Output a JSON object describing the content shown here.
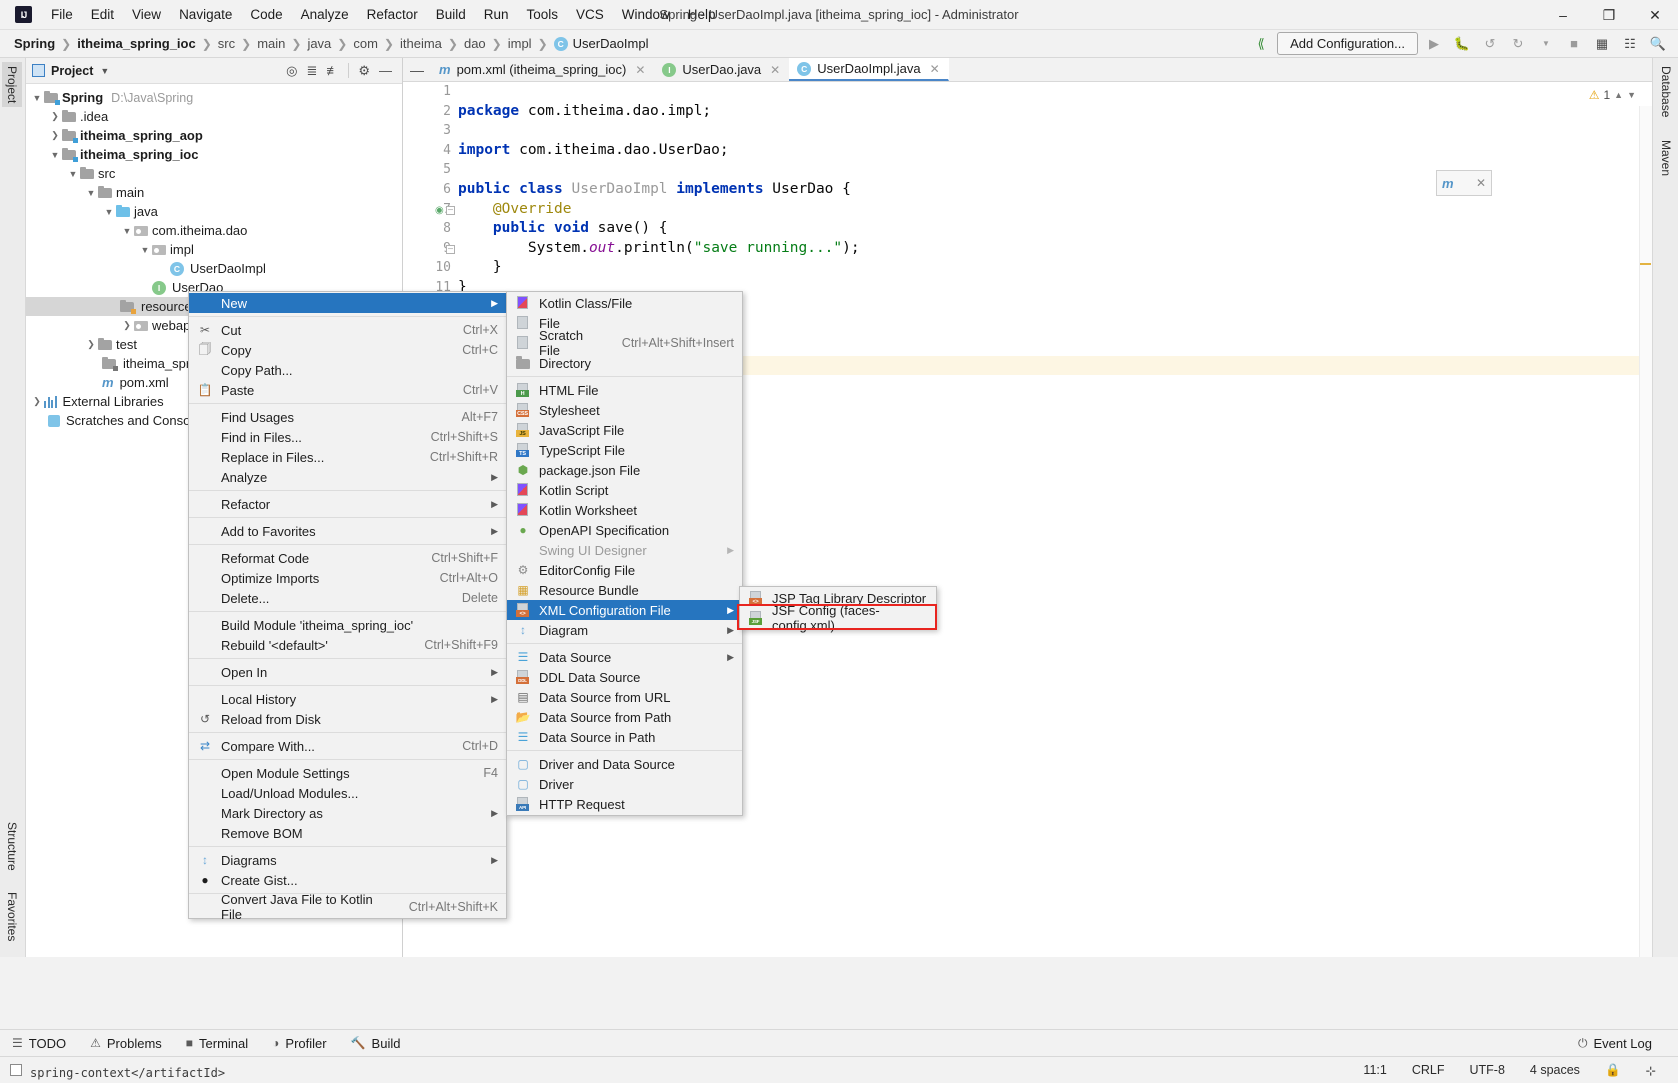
{
  "window": {
    "title": "Spring - UserDaoImpl.java [itheima_spring_ioc] - Administrator",
    "logo": "IJ",
    "minimize": "–",
    "maximize": "❐",
    "close": "✕"
  },
  "menubar": [
    {
      "label": "File"
    },
    {
      "label": "Edit"
    },
    {
      "label": "View"
    },
    {
      "label": "Navigate"
    },
    {
      "label": "Code"
    },
    {
      "label": "Analyze"
    },
    {
      "label": "Refactor"
    },
    {
      "label": "Build"
    },
    {
      "label": "Run"
    },
    {
      "label": "Tools"
    },
    {
      "label": "VCS"
    },
    {
      "label": "Window"
    },
    {
      "label": "Help"
    }
  ],
  "breadcrumb": [
    {
      "label": "Spring",
      "bold": true
    },
    {
      "label": "itheima_spring_ioc",
      "bold": true
    },
    {
      "label": "src"
    },
    {
      "label": "main"
    },
    {
      "label": "java"
    },
    {
      "label": "com"
    },
    {
      "label": "itheima"
    },
    {
      "label": "dao"
    },
    {
      "label": "impl"
    },
    {
      "label": "UserDaoImpl",
      "icon": "class-icon"
    }
  ],
  "toolbar": {
    "add_configuration": "Add Configuration...",
    "icons": [
      "build-icon",
      "run-icon",
      "debug-icon",
      "run-with-coverage-icon",
      "profile-icon",
      "stop-icon",
      "build-project-icon",
      "layout-icon",
      "search-everywhere-icon"
    ]
  },
  "left_tool_strip": [
    {
      "label": "Project",
      "selected": true
    },
    {
      "label": "Structure"
    },
    {
      "label": "Favorites"
    }
  ],
  "right_tool_strip": [
    {
      "label": "Database"
    },
    {
      "label": "Maven"
    }
  ],
  "project_panel": {
    "title": "Project",
    "header_icons": [
      "locate-icon",
      "expand-all-icon",
      "collapse-all-icon",
      "gear-icon",
      "hide-icon"
    ],
    "tree": [
      {
        "depth": 0,
        "twist": "v",
        "icon": "module-folder",
        "label": "Spring",
        "bold": true,
        "path": "D:\\Java\\Spring"
      },
      {
        "depth": 1,
        "twist": ">",
        "icon": "folder",
        "label": ".idea"
      },
      {
        "depth": 1,
        "twist": ">",
        "icon": "module-folder",
        "label": "itheima_spring_aop",
        "bold": true
      },
      {
        "depth": 1,
        "twist": "v",
        "icon": "module-folder",
        "label": "itheima_spring_ioc",
        "bold": true
      },
      {
        "depth": 2,
        "twist": "v",
        "icon": "folder",
        "label": "src"
      },
      {
        "depth": 3,
        "twist": "v",
        "icon": "folder",
        "label": "main"
      },
      {
        "depth": 4,
        "twist": "v",
        "icon": "source-folder",
        "label": "java"
      },
      {
        "depth": 5,
        "twist": "v",
        "icon": "package",
        "label": "com.itheima.dao"
      },
      {
        "depth": 6,
        "twist": "v",
        "icon": "package",
        "label": "impl"
      },
      {
        "depth": 7,
        "twist": "",
        "icon": "class",
        "label": "UserDaoImpl"
      },
      {
        "depth": 6,
        "twist": "",
        "icon": "interface",
        "label": "UserDao"
      },
      {
        "depth": 4,
        "twist": "",
        "icon": "resources-folder",
        "label": "resources",
        "selected": true
      },
      {
        "depth": 4,
        "twist": ">",
        "icon": "webapp-folder",
        "label": "webapp"
      },
      {
        "depth": 3,
        "twist": ">",
        "icon": "folder",
        "label": "test"
      },
      {
        "depth": 2,
        "twist": "",
        "icon": "module-file",
        "label": "itheima_spring_i"
      },
      {
        "depth": 2,
        "twist": "",
        "icon": "maven",
        "label": "pom.xml"
      },
      {
        "depth": 0,
        "twist": ">",
        "icon": "libraries",
        "label": "External Libraries"
      },
      {
        "depth": 0,
        "twist": "",
        "icon": "scratches",
        "label": "Scratches and Console"
      }
    ]
  },
  "editor": {
    "tabs": [
      {
        "label": "pom.xml (itheima_spring_ioc)",
        "icon": "maven-icon",
        "active": false,
        "closable": true
      },
      {
        "label": "UserDao.java",
        "icon": "interface-icon",
        "active": false,
        "closable": true
      },
      {
        "label": "UserDaoImpl.java",
        "icon": "class-icon",
        "active": true,
        "closable": true
      }
    ],
    "line_numbers": [
      "1",
      "2",
      "3",
      "4",
      "5",
      "6",
      "7",
      "8",
      "9",
      "10",
      "11"
    ],
    "code_lines": [
      "package com.itheima.dao.impl;",
      "",
      "import com.itheima.dao.UserDao;",
      "",
      "public class UserDaoImpl implements UserDao {",
      "    @Override",
      "    public void save() {",
      "        System.out.println(\"save running...\");",
      "    }",
      "}",
      ""
    ],
    "warning_count": "1",
    "warning_icon": "warning-triangle-icon"
  },
  "context_menu": {
    "items": [
      {
        "label": "New",
        "icon": "",
        "accel": "",
        "submenu": true,
        "highlight": true
      },
      {
        "sep": true
      },
      {
        "label": "Cut",
        "icon": "scissors-icon",
        "accel": "Ctrl+X"
      },
      {
        "label": "Copy",
        "icon": "copy-icon",
        "accel": "Ctrl+C"
      },
      {
        "label": "Copy Path...",
        "icon": "",
        "accel": ""
      },
      {
        "label": "Paste",
        "icon": "clipboard-icon",
        "accel": "Ctrl+V"
      },
      {
        "sep": true
      },
      {
        "label": "Find Usages",
        "icon": "",
        "accel": "Alt+F7"
      },
      {
        "label": "Find in Files...",
        "icon": "",
        "accel": "Ctrl+Shift+S"
      },
      {
        "label": "Replace in Files...",
        "icon": "",
        "accel": "Ctrl+Shift+R"
      },
      {
        "label": "Analyze",
        "icon": "",
        "accel": "",
        "submenu": true
      },
      {
        "sep": true
      },
      {
        "label": "Refactor",
        "icon": "",
        "accel": "",
        "submenu": true
      },
      {
        "sep": true
      },
      {
        "label": "Add to Favorites",
        "icon": "",
        "accel": "",
        "submenu": true
      },
      {
        "sep": true
      },
      {
        "label": "Reformat Code",
        "icon": "",
        "accel": "Ctrl+Shift+F"
      },
      {
        "label": "Optimize Imports",
        "icon": "",
        "accel": "Ctrl+Alt+O"
      },
      {
        "label": "Delete...",
        "icon": "",
        "accel": "Delete"
      },
      {
        "sep": true
      },
      {
        "label": "Build Module 'itheima_spring_ioc'",
        "icon": "",
        "accel": ""
      },
      {
        "label": "Rebuild '<default>'",
        "icon": "",
        "accel": "Ctrl+Shift+F9"
      },
      {
        "sep": true
      },
      {
        "label": "Open In",
        "icon": "",
        "accel": "",
        "submenu": true
      },
      {
        "sep": true
      },
      {
        "label": "Local History",
        "icon": "",
        "accel": "",
        "submenu": true
      },
      {
        "label": "Reload from Disk",
        "icon": "reload-icon",
        "accel": ""
      },
      {
        "sep": true
      },
      {
        "label": "Compare With...",
        "icon": "compare-icon",
        "accel": "Ctrl+D"
      },
      {
        "sep": true
      },
      {
        "label": "Open Module Settings",
        "icon": "",
        "accel": "F4"
      },
      {
        "label": "Load/Unload Modules...",
        "icon": "",
        "accel": ""
      },
      {
        "label": "Mark Directory as",
        "icon": "",
        "accel": "",
        "submenu": true
      },
      {
        "label": "Remove BOM",
        "icon": "",
        "accel": ""
      },
      {
        "sep": true
      },
      {
        "label": "Diagrams",
        "icon": "diagram-icon",
        "accel": "",
        "submenu": true
      },
      {
        "label": "Create Gist...",
        "icon": "github-icon",
        "accel": ""
      },
      {
        "sep": true
      },
      {
        "label": "Convert Java File to Kotlin File",
        "icon": "",
        "accel": "Ctrl+Alt+Shift+K"
      }
    ]
  },
  "new_submenu": {
    "items": [
      {
        "label": "Kotlin Class/File",
        "icon": "kotlin-icon",
        "accel": ""
      },
      {
        "label": "File",
        "icon": "file-icon",
        "accel": ""
      },
      {
        "label": "Scratch File",
        "icon": "scratch-file-icon",
        "accel": "Ctrl+Alt+Shift+Insert"
      },
      {
        "label": "Directory",
        "icon": "directory-icon",
        "accel": ""
      },
      {
        "sep": true
      },
      {
        "label": "HTML File",
        "icon": "html-file-icon",
        "accel": ""
      },
      {
        "label": "Stylesheet",
        "icon": "css-file-icon",
        "accel": ""
      },
      {
        "label": "JavaScript File",
        "icon": "js-file-icon",
        "accel": ""
      },
      {
        "label": "TypeScript File",
        "icon": "ts-file-icon",
        "accel": ""
      },
      {
        "label": "package.json File",
        "icon": "nodejs-icon",
        "accel": ""
      },
      {
        "label": "Kotlin Script",
        "icon": "kotlin-icon",
        "accel": ""
      },
      {
        "label": "Kotlin Worksheet",
        "icon": "kotlin-icon",
        "accel": ""
      },
      {
        "label": "OpenAPI Specification",
        "icon": "openapi-icon",
        "accel": ""
      },
      {
        "label": "Swing UI Designer",
        "icon": "",
        "accel": "",
        "disabled": true,
        "submenu": true
      },
      {
        "label": "EditorConfig File",
        "icon": "gear-icon",
        "accel": ""
      },
      {
        "label": "Resource Bundle",
        "icon": "resource-bundle-icon",
        "accel": ""
      },
      {
        "label": "XML Configuration File",
        "icon": "xml-file-icon",
        "accel": "",
        "submenu": true,
        "highlight": true
      },
      {
        "label": "Diagram",
        "icon": "diagram-icon",
        "accel": "",
        "submenu": true
      },
      {
        "sep": true
      },
      {
        "label": "Data Source",
        "icon": "database-icon",
        "accel": "",
        "submenu": true
      },
      {
        "label": "DDL Data Source",
        "icon": "ddl-icon",
        "accel": ""
      },
      {
        "label": "Data Source from URL",
        "icon": "url-source-icon",
        "accel": ""
      },
      {
        "label": "Data Source from Path",
        "icon": "folder-open-icon",
        "accel": ""
      },
      {
        "label": "Data Source in Path",
        "icon": "database-icon",
        "accel": ""
      },
      {
        "sep": true
      },
      {
        "label": "Driver and Data Source",
        "icon": "driver-icon",
        "accel": ""
      },
      {
        "label": "Driver",
        "icon": "driver-icon",
        "accel": ""
      },
      {
        "label": "HTTP Request",
        "icon": "http-request-icon",
        "accel": ""
      }
    ]
  },
  "xml_submenu": {
    "items": [
      {
        "label": "JSP Tag Library Descriptor",
        "icon": "jsp-tld-icon",
        "submenu": true
      },
      {
        "label": "JSF Config (faces-config.xml)",
        "icon": "jsf-icon",
        "submenu": true,
        "boxed": true
      }
    ]
  },
  "bottom_bar": {
    "items": [
      {
        "label": "TODO",
        "icon": "todo-icon"
      },
      {
        "label": "Problems",
        "icon": "problems-icon"
      },
      {
        "label": "Terminal",
        "icon": "terminal-icon"
      },
      {
        "label": "Profiler",
        "icon": "profiler-icon"
      },
      {
        "label": "Build",
        "icon": "build-icon"
      }
    ],
    "event_log": "Event Log",
    "event_log_icon": "event-log-icon"
  },
  "status_bar": {
    "caret": "11:1",
    "line_separator": "CRLF",
    "encoding": "UTF-8",
    "indent": "4 spaces",
    "lock_icon": "lock-icon",
    "branch_icon": "branch-icon",
    "partial_text": "spring-context</artifactId>"
  }
}
